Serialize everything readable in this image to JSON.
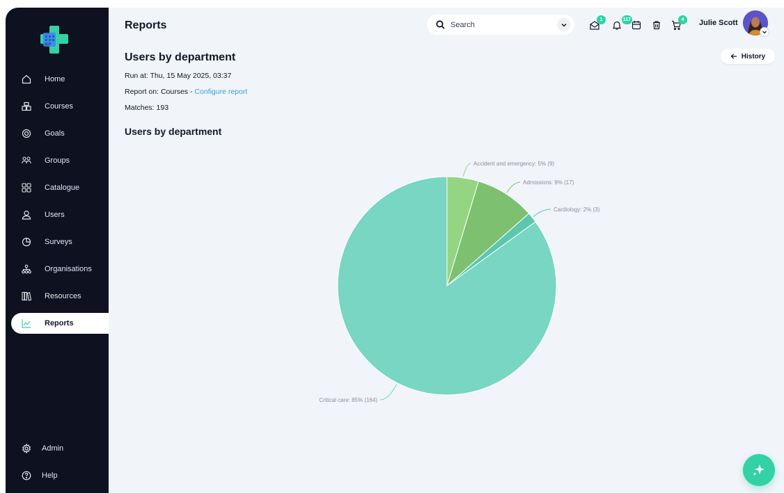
{
  "sidebar": {
    "items": [
      {
        "label": "Home",
        "icon": "home-icon"
      },
      {
        "label": "Courses",
        "icon": "courses-icon"
      },
      {
        "label": "Goals",
        "icon": "goals-icon"
      },
      {
        "label": "Groups",
        "icon": "groups-icon"
      },
      {
        "label": "Catalogue",
        "icon": "catalogue-icon"
      },
      {
        "label": "Users",
        "icon": "user-icon"
      },
      {
        "label": "Surveys",
        "icon": "surveys-icon"
      },
      {
        "label": "Organisations",
        "icon": "organisations-icon"
      },
      {
        "label": "Resources",
        "icon": "resources-icon"
      },
      {
        "label": "Reports",
        "icon": "reports-icon",
        "active": true
      }
    ],
    "bottom_items": [
      {
        "label": "Admin",
        "icon": "gear-icon"
      },
      {
        "label": "Help",
        "icon": "help-icon"
      }
    ]
  },
  "header": {
    "page_title": "Reports",
    "search_placeholder": "Search",
    "badges": {
      "messages": "1",
      "notifications": "117",
      "cart": "4"
    },
    "user_name": "Julie Scott"
  },
  "report": {
    "title": "Users by department",
    "run_at": "Run at: Thu, 15 May 2025, 03:37",
    "report_on_prefix": "Report on: Courses - ",
    "configure_link": "Configure report",
    "matches": "Matches: 193",
    "history_label": "History"
  },
  "chart_data": {
    "type": "pie",
    "title": "Users by department",
    "slices": [
      {
        "label": "Accident and emergency: 5% (9)",
        "category": "Accident and emergency",
        "value": 9,
        "percent": 5,
        "color": "#94d582"
      },
      {
        "label": "Admissions: 9% (17)",
        "category": "Admissions",
        "value": 17,
        "percent": 9,
        "color": "#7cc070"
      },
      {
        "label": "Cardiology: 2% (3)",
        "category": "Cardiology",
        "value": 3,
        "percent": 2,
        "color": "#5cc7ae"
      },
      {
        "label": "Critical care: 85% (164)",
        "category": "Critical care",
        "value": 164,
        "percent": 85,
        "color": "#78d6c2"
      }
    ],
    "total": 193,
    "legend": "none"
  },
  "colors": {
    "sidebar_bg": "#0d1120",
    "accent": "#2dd4a4",
    "link": "#3b9fd8"
  }
}
